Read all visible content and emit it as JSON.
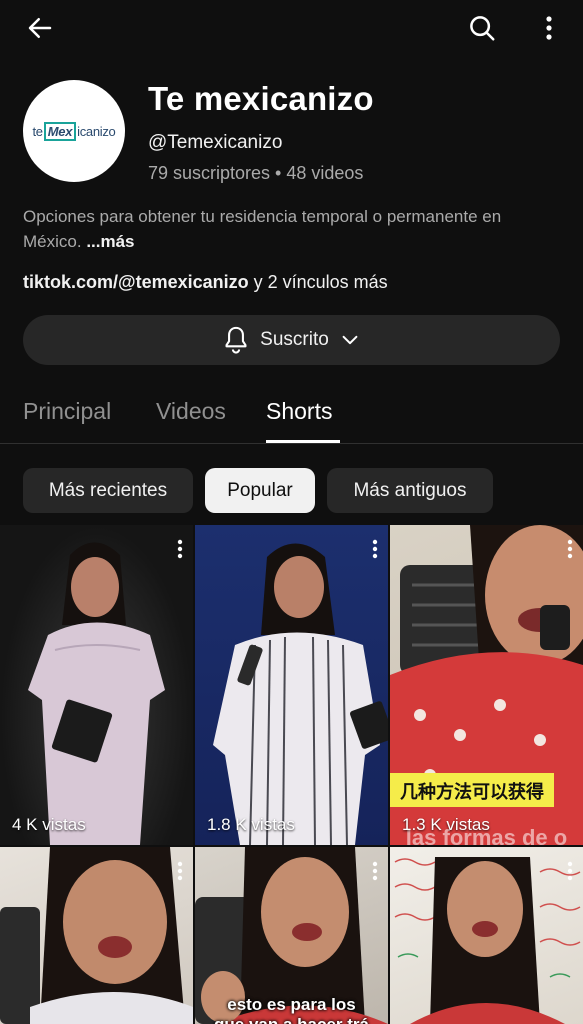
{
  "header": {
    "back_icon": "arrow-left-icon",
    "search_icon": "search-icon",
    "more_icon": "more-vertical-icon"
  },
  "channel": {
    "logo_text_pre": "te",
    "logo_text_box": "Mex",
    "logo_text_post": "icanizo",
    "name": "Te mexicanizo",
    "handle": "@Temexicanizo",
    "stats": "79 suscriptores • 48 videos",
    "description": "Opciones para obtener tu residencia temporal o permanente en México.",
    "description_more": "...más",
    "link_main": "tiktok.com/@temexicanizo",
    "link_rest": " y 2 vínculos más",
    "subscribe_label": "Suscrito"
  },
  "tabs": [
    {
      "label": "Principal"
    },
    {
      "label": "Videos"
    },
    {
      "label": "Shorts",
      "active": true
    }
  ],
  "chips": [
    {
      "label": "Más recientes"
    },
    {
      "label": "Popular",
      "selected": true
    },
    {
      "label": "Más antiguos"
    }
  ],
  "shorts": [
    {
      "views": "4 K vistas"
    },
    {
      "views": "1.8 K vistas"
    },
    {
      "views": "1.3 K vistas",
      "overlay_text": "几种方法可以获得",
      "overlay_text2": "las formas de o"
    },
    {
      "views": ""
    },
    {
      "views": "",
      "overlay_text": "esto es para los",
      "overlay_text2": "que van a hacer trá"
    },
    {
      "views": ""
    }
  ],
  "colors": {
    "background": "#0f0f0f",
    "chip_bg": "#272727",
    "chip_selected_bg": "#f1f1f1",
    "secondary_text": "#aaaaaa"
  }
}
